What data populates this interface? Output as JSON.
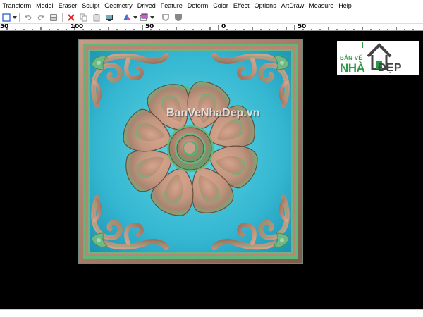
{
  "menu": {
    "items": [
      "Transform",
      "Model",
      "Eraser",
      "Sculpt",
      "Geometry",
      "Drived",
      "Feature",
      "Deform",
      "Color",
      "Effect",
      "Options",
      "ArtDraw",
      "Measure",
      "Help"
    ]
  },
  "toolbar": {
    "icons": [
      "select-icon",
      "dropdown-arrow-icon",
      "undo-icon",
      "redo-icon",
      "save-icon",
      "delete-icon",
      "copy-icon",
      "paste-icon",
      "display-icon",
      "color-mode-icon",
      "dropdown-arrow-icon",
      "view-icon",
      "dropdown-arrow-icon",
      "shield-icon",
      "shield-filled-icon"
    ]
  },
  "ruler": {
    "labels": [
      "50",
      "100",
      "50",
      "0",
      "50"
    ]
  },
  "logo": {
    "line1": "BẢN VẼ",
    "line2": "NHÀ",
    "line3": "ĐẸP"
  },
  "watermark": "BanVeNhaDep.vn",
  "colors": {
    "canvas": "#000000",
    "relief_bg": "#3fc0d4",
    "relief_frame": "#b98a74",
    "relief_green": "#5fb87a",
    "logo_green": "#2d9a47"
  }
}
